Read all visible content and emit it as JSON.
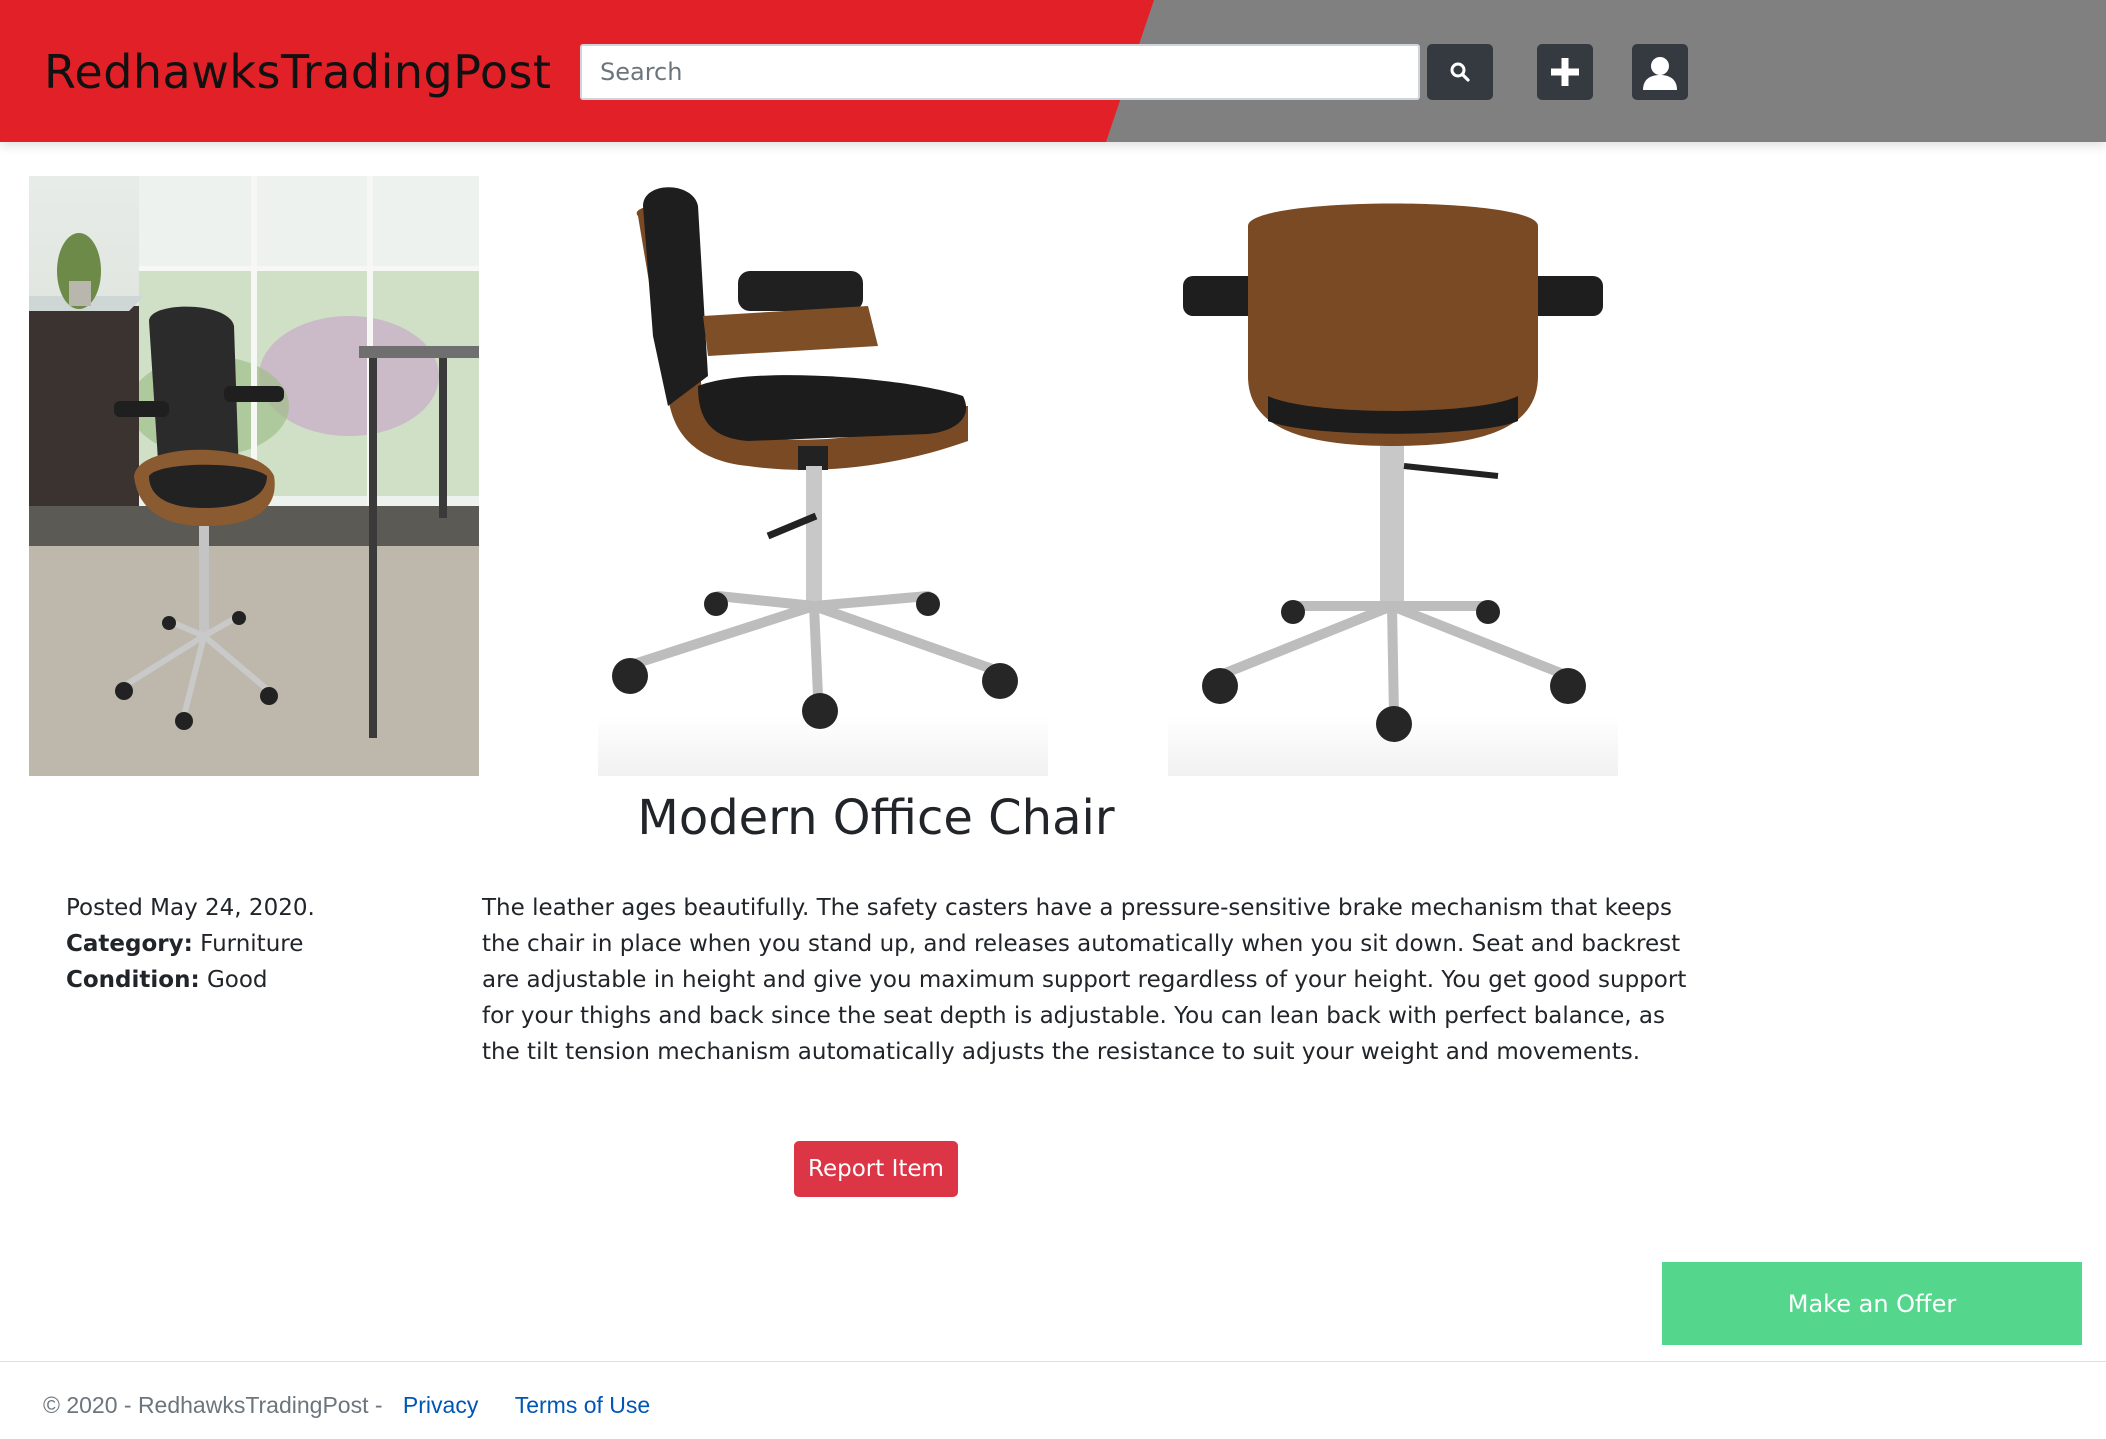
{
  "header": {
    "logo": "RedhawksTradingPost",
    "search_placeholder": "Search",
    "search_icon": "magnifier-icon",
    "add_icon": "plus-icon",
    "account_icon": "person-icon",
    "colors": {
      "red": "#e12127",
      "gray": "#808080",
      "button": "#343a40"
    }
  },
  "item": {
    "title": "Modern Office Chair",
    "posted": "Posted May 24, 2020.",
    "category_label": "Category:",
    "category": "Furniture",
    "condition_label": "Condition:",
    "condition": "Good",
    "description": "The leather ages beautifully. The safety casters have a pressure-sensitive brake mechanism that keeps the chair in place when you stand up, and releases automatically when you sit down. Seat and backrest are adjustable in height and give you maximum support regardless of your height. You get good support for your thighs and back since the seat depth is adjustable. You can lean back with perfect balance, as the tilt tension mechanism automatically adjusts the resistance to suit your weight and movements."
  },
  "actions": {
    "report": "Report Item",
    "offer": "Make an Offer",
    "colors": {
      "report": "#dc3545",
      "offer": "#55d68d"
    }
  },
  "footer": {
    "copyright": "© 2020 - RedhawksTradingPost -",
    "privacy": "Privacy",
    "terms": "Terms of Use"
  }
}
